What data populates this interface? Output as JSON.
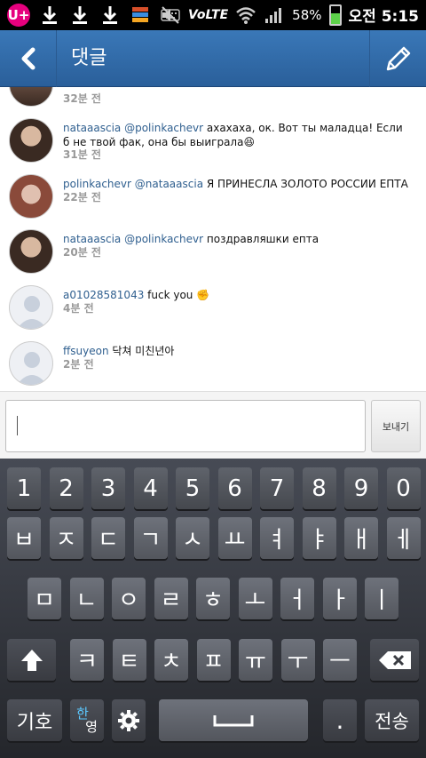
{
  "status_bar": {
    "carrier_logo": "U+",
    "volte": "VoLTE",
    "battery_text": "58%",
    "battery_level": 0.58,
    "time": "오전 5:15",
    "icons": [
      "download-icon",
      "download-icon",
      "download-icon",
      "app-icon",
      "keyboard-icon",
      "mute-icon",
      "wifi-icon",
      "signal-icon"
    ]
  },
  "action_bar": {
    "title": "댓글",
    "back_icon": "chevron-left-icon",
    "edit_icon": "pencil-icon"
  },
  "comments": [
    {
      "username": "",
      "text": "",
      "time": "32분 전",
      "avatar_color": "#6a4a3a"
    },
    {
      "username": "nataaascia",
      "mention": "@polinkachevr",
      "text": "ахахаха, ок. Вот ты маладца! Если б не твой фак, она бы выиграла",
      "emoji": "😆",
      "time": "31분 전",
      "avatar_color": "#4a3a2e"
    },
    {
      "username": "polinkachevr",
      "mention": "@nataaascia",
      "text": "Я ПРИНЕСЛА ЗОЛОТО РОССИИ ЕПТА",
      "emoji": "",
      "time": "22분 전",
      "avatar_color": "#7a4a3a"
    },
    {
      "username": "nataaascia",
      "mention": "@polinkachevr",
      "text": "поздравляшки епта",
      "emoji": "",
      "time": "20분 전",
      "avatar_color": "#4a3a2e"
    },
    {
      "username": "a01028581043",
      "mention": "",
      "text": "fuck you",
      "emoji": "✊",
      "time": "4분 전",
      "avatar_color": "default"
    },
    {
      "username": "ffsuyeon",
      "mention": "",
      "text": "닥쳐 미친년아",
      "emoji": "",
      "time": "2분 전",
      "avatar_color": "default"
    }
  ],
  "input": {
    "value": "",
    "placeholder": "",
    "send_label": "보내기"
  },
  "keyboard": {
    "row_numbers": [
      "1",
      "2",
      "3",
      "4",
      "5",
      "6",
      "7",
      "8",
      "9",
      "0"
    ],
    "row1": [
      "ㅂ",
      "ㅈ",
      "ㄷ",
      "ㄱ",
      "ㅅ",
      "ㅛ",
      "ㅕ",
      "ㅑ",
      "ㅐ",
      "ㅔ"
    ],
    "row2": [
      "ㅁ",
      "ㄴ",
      "ㅇ",
      "ㄹ",
      "ㅎ",
      "ㅗ",
      "ㅓ",
      "ㅏ",
      "ㅣ"
    ],
    "row3": [
      "ㅋ",
      "ㅌ",
      "ㅊ",
      "ㅍ",
      "ㅠ",
      "ㅜ",
      "ㅡ"
    ],
    "symbols_label": "기호",
    "lang_label_top": "한",
    "lang_label_bottom": "영",
    "period_label": ".",
    "enter_label": "전송",
    "shift_icon": "shift-arrow-icon",
    "backspace_icon": "backspace-icon",
    "settings_icon": "gear-icon",
    "space_icon": "spacebar-icon"
  },
  "colors": {
    "accent": "#2f5f8f",
    "actionbar": "#3a78b8"
  }
}
